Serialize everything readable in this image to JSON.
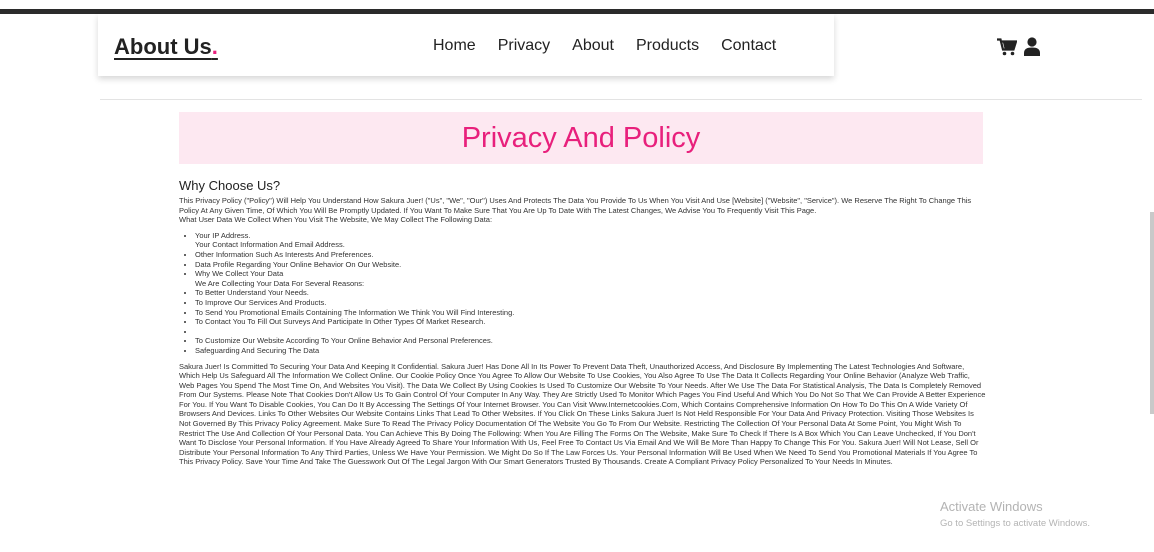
{
  "header": {
    "brand": "About Us",
    "brand_dot": ".",
    "nav": [
      "Home",
      "Privacy",
      "About",
      "Products",
      "Contact"
    ],
    "icons": [
      "cart-icon",
      "user-icon"
    ]
  },
  "banner": {
    "title": "Privacy And Policy"
  },
  "content": {
    "heading": "Why Choose Us?",
    "intro": "This Privacy Policy (\"Policy\") Will Help You Understand How Sakura Juer! (\"Us\", \"We\", \"Our\") Uses And Protects The Data You Provide To Us When You Visit And Use [Website] (\"Website\", \"Service\"). We Reserve The Right To Change This Policy At Any Given Time, Of Which You Will Be Promptly Updated. If You Want To Make Sure That You Are Up To Date With The Latest Changes, We Advise You To Frequently Visit This Page.",
    "collect_line": "What User Data We Collect When You Visit The Website, We May Collect The Following Data:",
    "list": [
      "Your IP Address.",
      "Your Contact Information And Email Address.",
      "Other Information Such As Interests And Preferences.",
      "Data Profile Regarding Your Online Behavior On Our Website.",
      "Why We Collect Your Data",
      "We Are Collecting Your Data For Several Reasons:",
      "To Better Understand Your Needs.",
      "To Improve Our Services And Products.",
      "To Send You Promotional Emails Containing The Information We Think You Will Find Interesting.",
      "To Contact You To Fill Out Surveys And Participate In Other Types Of Market Research.",
      "",
      "To Customize Our Website According To Your Online Behavior And Personal Preferences.",
      "Safeguarding And Securing The Data"
    ],
    "body": "Sakura Juer! Is Committed To Securing Your Data And Keeping It Confidential. Sakura Juer! Has Done All In Its Power To Prevent Data Theft, Unauthorized Access, And Disclosure By Implementing The Latest Technologies And Software, Which Help Us Safeguard All The Information We Collect Online. Our Cookie Policy Once You Agree To Allow Our Website To Use Cookies, You Also Agree To Use The Data It Collects Regarding Your Online Behavior (Analyze Web Traffic, Web Pages You Spend The Most Time On, And Websites You Visit). The Data We Collect By Using Cookies Is Used To Customize Our Website To Your Needs. After We Use The Data For Statistical Analysis, The Data Is Completely Removed From Our Systems. Please Note That Cookies Don't Allow Us To Gain Control Of Your Computer In Any Way. They Are Strictly Used To Monitor Which Pages You Find Useful And Which You Do Not So That We Can Provide A Better Experience For You. If You Want To Disable Cookies, You Can Do It By Accessing The Settings Of Your Internet Browser. You Can Visit Www.Internetcookies.Com, Which Contains Comprehensive Information On How To Do This On A Wide Variety Of Browsers And Devices. Links To Other Websites Our Website Contains Links That Lead To Other Websites. If You Click On These Links Sakura Juer! Is Not Held Responsible For Your Data And Privacy Protection. Visiting Those Websites Is Not Governed By This Privacy Policy Agreement. Make Sure To Read The Privacy Policy Documentation Of The Website You Go To From Our Website. Restricting The Collection Of Your Personal Data At Some Point, You Might Wish To Restrict The Use And Collection Of Your Personal Data. You Can Achieve This By Doing The Following: When You Are Filling The Forms On The Website, Make Sure To Check If There Is A Box Which You Can Leave Unchecked, If You Don't Want To Disclose Your Personal Information. If You Have Already Agreed To Share Your Information With Us, Feel Free To Contact Us Via Email And We Will Be More Than Happy To Change This For You. Sakura Juer! Will Not Lease, Sell Or Distribute Your Personal Information To Any Third Parties, Unless We Have Your Permission. We Might Do So If The Law Forces Us. Your Personal Information Will Be Used When We Need To Send You Promotional Materials If You Agree To This Privacy Policy. Save Your Time And Take The Guesswork Out Of The Legal Jargon With Our Smart Generators Trusted By Thousands. Create A Compliant Privacy Policy Personalized To Your Needs In Minutes."
  },
  "watermark": {
    "line1": "Activate Windows",
    "line2": "Go to Settings to activate Windows."
  },
  "colors": {
    "accent": "#e8207c",
    "banner_bg": "#fde8f1",
    "topbar": "#2b2b2b"
  }
}
